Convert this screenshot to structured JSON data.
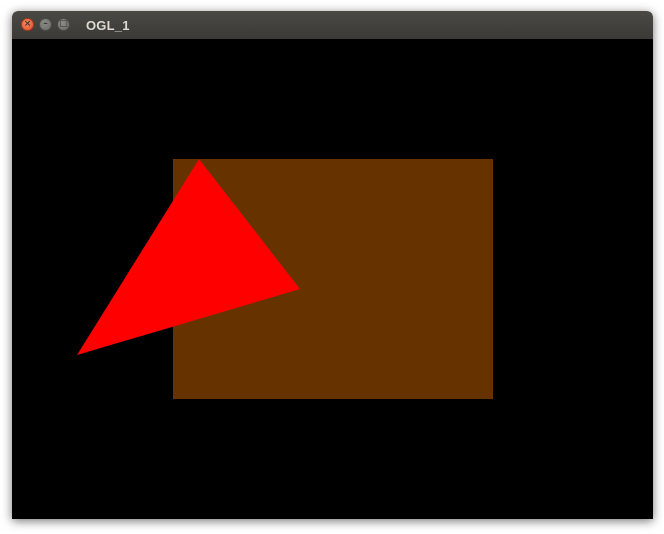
{
  "window": {
    "title": "OGL_1",
    "controls": {
      "close_icon": "close-icon",
      "minimize_icon": "minimize-icon",
      "maximize_icon": "maximize-icon"
    }
  },
  "scene": {
    "background_color": "#000000",
    "rectangle_color": "#663300",
    "triangle_color": "#ff0000"
  }
}
